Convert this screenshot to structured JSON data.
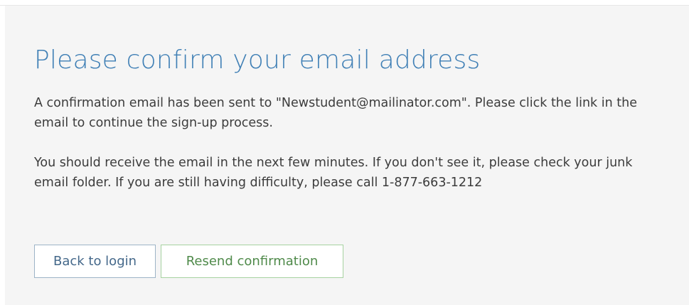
{
  "confirm": {
    "title": "Please confirm your email address",
    "message_1": "A confirmation email has been sent to \"Newstudent@mailinator.com\". Please click the link in the email to continue the sign-up process.",
    "message_2": "You should receive the email in the next few minutes. If you don't see it, please check your junk email folder. If you are still having difficulty, please call 1-877-663-1212",
    "back_button_label": "Back to login",
    "resend_button_label": "Resend confirmation"
  },
  "colors": {
    "title": "#3f7fb5",
    "panel_background": "#f5f5f5",
    "body_text": "#3c3c3c",
    "back_button_border": "#9db4c7",
    "back_button_text": "#44688a",
    "resend_button_border": "#a6d2a0",
    "resend_button_text": "#4f8a4a"
  }
}
